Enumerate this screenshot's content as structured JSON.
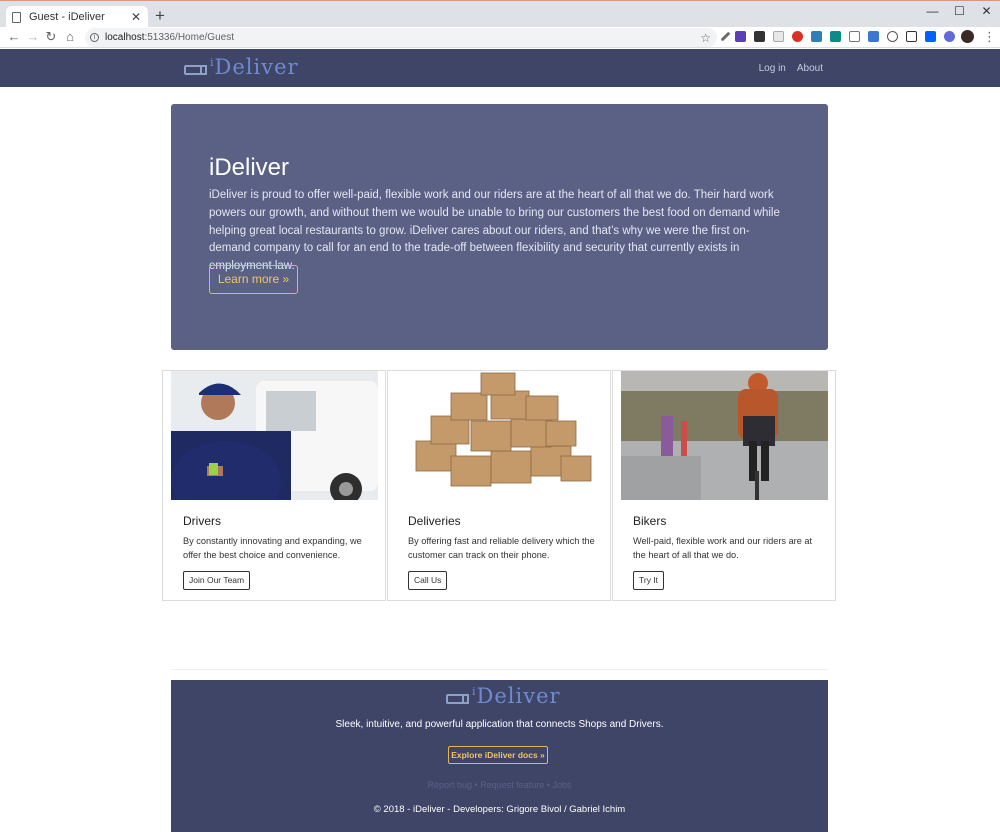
{
  "browser": {
    "tab_title": "Guest - iDeliver",
    "url": "localhost:51336/Home/Guest",
    "url_host": "localhost",
    "url_rest": ":51336/Home/Guest"
  },
  "nav": {
    "brand": "Deliver",
    "brand_i": "i",
    "links": [
      "Log in",
      "About"
    ]
  },
  "hero": {
    "title": "iDeliver",
    "text": "iDeliver is proud to offer well-paid, flexible work and our riders are at the heart of all that we do. Their hard work powers our growth, and without them we would be unable to bring our customers the best food on demand while helping great local restaurants to grow. iDeliver cares about our riders, and that’s why we were the first on-demand company to call for an end to the trade-off between flexibility and security that currently exists in employment law.",
    "button": "Learn more »"
  },
  "cards": [
    {
      "title": "Drivers",
      "text": "By constantly innovating and expanding, we offer the best choice and convenience.",
      "button": "Join Our Team",
      "image": "delivery-man-photo"
    },
    {
      "title": "Deliveries",
      "text": "By offering fast and reliable delivery which the customer can track on their phone.",
      "button": "Call Us",
      "image": "cardboard-boxes-photo"
    },
    {
      "title": "Bikers",
      "text": "Well-paid, flexible work and our riders are at the heart of all that we do.",
      "button": "Try It",
      "image": "cyclist-photo"
    }
  ],
  "footer": {
    "brand": "Deliver",
    "brand_i": "i",
    "tagline": "Sleek, intuitive, and powerful application that connects Shops and Drivers.",
    "docs_button": "Explore iDeliver docs »",
    "links": [
      "Report bug",
      "Request feature",
      "Jobs"
    ],
    "separator": "•",
    "copyright": "© 2018 - iDeliver - Developers: Grigore Bivol / Gabriel Ichim"
  },
  "colors": {
    "navbar": "#3e4567",
    "hero": "#5a6185",
    "accent": "#f0c46b"
  }
}
